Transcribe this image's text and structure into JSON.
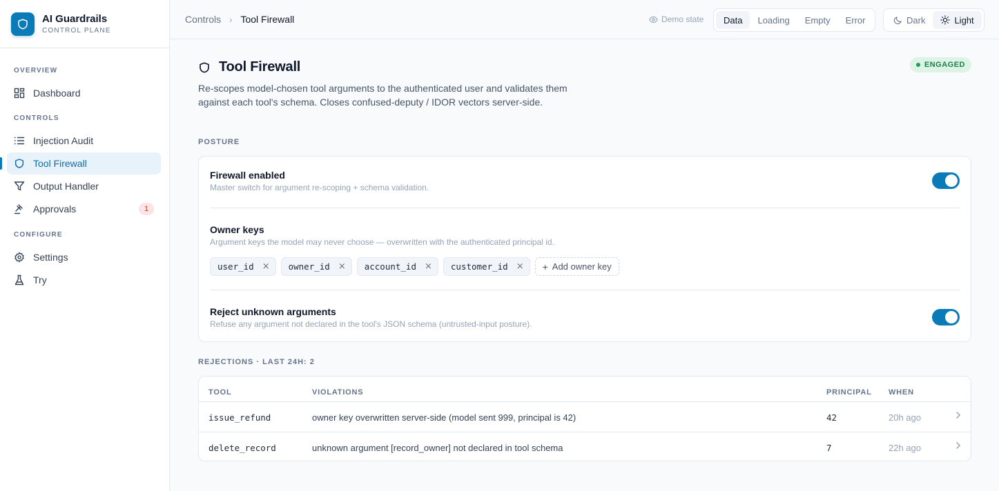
{
  "brand": {
    "title": "AI Guardrails",
    "subtitle": "CONTROL PLANE"
  },
  "sidebar": {
    "sections": [
      {
        "label": "OVERVIEW"
      },
      {
        "label": "CONTROLS"
      },
      {
        "label": "CONFIGURE"
      }
    ],
    "items": [
      {
        "label": "Dashboard",
        "icon": "dashboard-grid-icon"
      },
      {
        "label": "Injection Audit",
        "icon": "list-icon"
      },
      {
        "label": "Tool Firewall",
        "icon": "shield-icon",
        "active": true
      },
      {
        "label": "Output Handler",
        "icon": "filter-icon"
      },
      {
        "label": "Approvals",
        "icon": "gavel-icon",
        "badge": "1"
      },
      {
        "label": "Settings",
        "icon": "gear-icon"
      },
      {
        "label": "Try",
        "icon": "flask-icon"
      }
    ]
  },
  "topbar": {
    "breadcrumb": {
      "parent": "Controls",
      "separator": "›",
      "current": "Tool Firewall"
    },
    "demo_label": "Demo state",
    "demo_states": [
      "Data",
      "Loading",
      "Empty",
      "Error"
    ],
    "demo_selected": "Data",
    "themes": [
      "Dark",
      "Light"
    ],
    "theme_selected": "Light"
  },
  "page": {
    "title": "Tool Firewall",
    "status": "ENGAGED",
    "description": "Re-scopes model-chosen tool arguments to the authenticated user and validates them against each tool's schema. Closes confused-deputy / IDOR vectors server-side."
  },
  "posture": {
    "label": "POSTURE",
    "firewall": {
      "title": "Firewall enabled",
      "subtitle": "Master switch for argument re-scoping + schema validation.",
      "on": true
    },
    "owner_keys": {
      "title": "Owner keys",
      "subtitle": "Argument keys the model may never choose — overwritten with the authenticated principal id.",
      "keys": [
        "user_id",
        "owner_id",
        "account_id",
        "customer_id"
      ],
      "remove_glyph": "×",
      "add_label": "Add owner key"
    },
    "reject_unknown": {
      "title": "Reject unknown arguments",
      "subtitle": "Refuse any argument not declared in the tool's JSON schema (untrusted-input posture).",
      "on": true
    }
  },
  "rejections": {
    "label": "REJECTIONS · LAST 24H: 2",
    "columns": [
      "TOOL",
      "VIOLATIONS",
      "PRINCIPAL",
      "WHEN"
    ],
    "rows": [
      {
        "tool": "issue_refund",
        "violation": "owner key overwritten server-side (model sent 999, principal is 42)",
        "principal": "42",
        "when": "20h ago"
      },
      {
        "tool": "delete_record",
        "violation": "unknown argument [record_owner] not declared in tool schema",
        "principal": "7",
        "when": "22h ago"
      }
    ]
  },
  "colors": {
    "accent": "#0b7bb8",
    "engaged_bg": "#dcf3e6",
    "engaged_text": "#1a7f4b",
    "badge_bg": "#fde4e4"
  }
}
